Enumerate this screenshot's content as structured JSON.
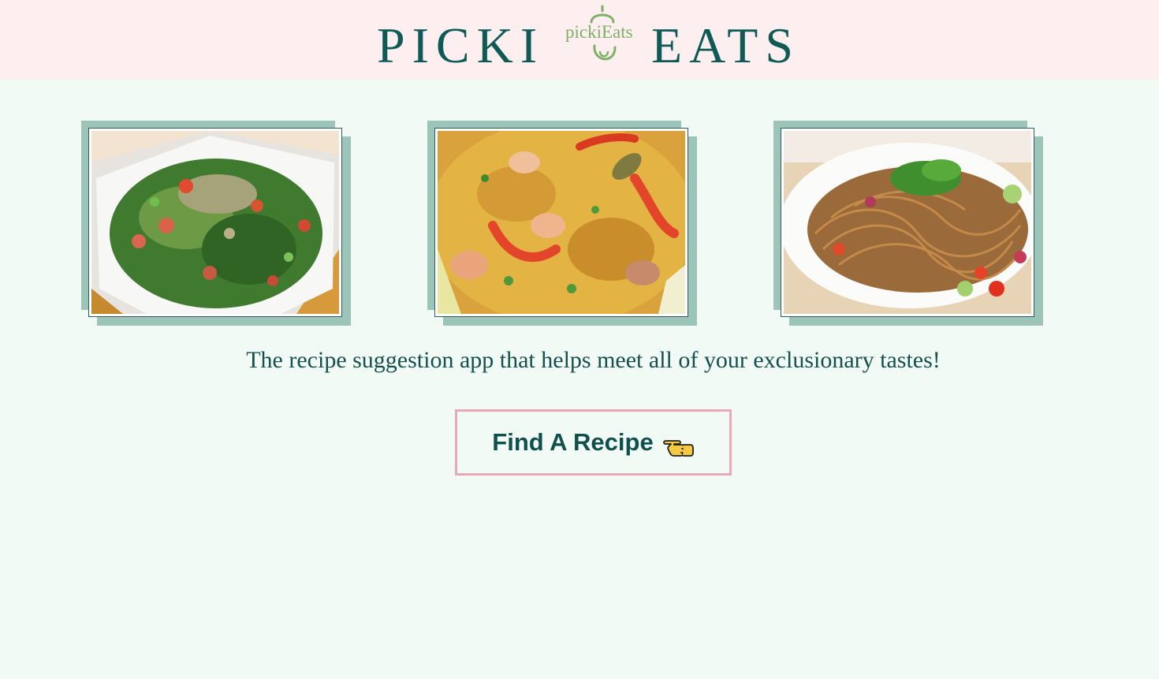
{
  "header": {
    "brand_left": "PICKI",
    "brand_right": "EATS",
    "logo_text": "pickiEats",
    "background": "#fdeef0",
    "brand_color": "#0f5a55",
    "logo_color": "#7fb067"
  },
  "gallery": [
    {
      "name": "tabbouleh-salad-photo",
      "icon": "food-photo"
    },
    {
      "name": "paella-photo",
      "icon": "food-photo"
    },
    {
      "name": "noodle-salad-photo",
      "icon": "food-photo"
    }
  ],
  "tagline": "The recipe suggestion app that helps meet all of your exclusionary tastes!",
  "cta": {
    "label": "Find A Recipe",
    "icon": "pointing-hand-icon",
    "border_color": "#e9a8b8"
  },
  "colors": {
    "page_background": "#f2faf6",
    "text": "#15504c",
    "frame_shadow": "#9cc4b8"
  }
}
